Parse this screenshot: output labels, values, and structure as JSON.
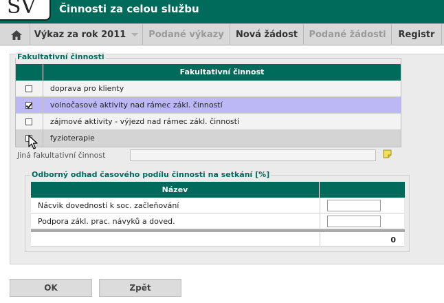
{
  "header": {
    "logo_text": "SV",
    "title": "Činnosti za celou službu"
  },
  "nav": {
    "items": [
      {
        "label": "Výkaz za rok 2011",
        "state": "active"
      },
      {
        "label": "Podané výkazy",
        "state": "disabled"
      },
      {
        "label": "Nová žádost",
        "state": "active"
      },
      {
        "label": "Podané žádosti",
        "state": "disabled"
      },
      {
        "label": "Registr",
        "state": "active"
      }
    ]
  },
  "fakultativni": {
    "legend": "Fakultativní činnosti",
    "column_header": "Fakultativní činnost",
    "rows": [
      {
        "label": "doprava pro klienty",
        "checked": false,
        "background": "#f3f3f3"
      },
      {
        "label": "volnočasové aktivity nad rámec zákl. činností",
        "checked": true,
        "background": "#bcb7f5"
      },
      {
        "label": "zájmové aktivity - výjezd nad rámec zákl. činností",
        "checked": false,
        "background": "#f3f3f3"
      },
      {
        "label": "fyzioterapie",
        "checked": false,
        "background": "#d4d4d4"
      }
    ],
    "jina_label": "Jiná fakultativní činnost",
    "jina_value": ""
  },
  "odhad": {
    "legend": "Odborný odhad časového podílu činnosti na setkání [%]",
    "column_header": "Název",
    "rows": [
      {
        "name": "Nácvik dovedností k soc. začleňování",
        "value": ""
      },
      {
        "name": "Podpora zákl. prac. návyků a doved.",
        "value": ""
      }
    ],
    "total": "0"
  },
  "buttons": {
    "ok": "OK",
    "back": "Zpět"
  },
  "colors": {
    "brand": "#006a5b",
    "selected_row": "#bcb7f5"
  },
  "icons": {
    "home": "home-icon",
    "note": "note-icon",
    "cursor": "mouse-pointer-icon"
  }
}
